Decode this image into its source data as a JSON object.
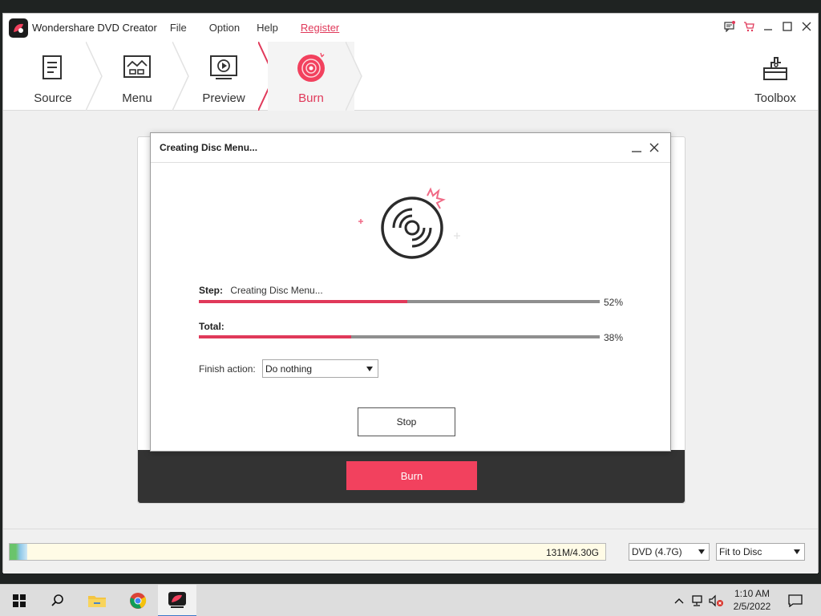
{
  "window": {
    "title": "Wondershare DVD Creator",
    "menu": [
      "File",
      "Option",
      "Help"
    ],
    "register": "Register"
  },
  "steps": [
    {
      "label": "Source",
      "icon": "document-icon",
      "active": false
    },
    {
      "label": "Menu",
      "icon": "image-grid-icon",
      "active": false
    },
    {
      "label": "Preview",
      "icon": "play-screen-icon",
      "active": false
    },
    {
      "label": "Burn",
      "icon": "disc-icon",
      "active": true
    }
  ],
  "toolbox": {
    "label": "Toolbox",
    "icon": "toolbox-icon"
  },
  "dialog": {
    "title": "Creating Disc Menu...",
    "step_label": "Step:",
    "step_value": "Creating Disc Menu...",
    "step_percent": "52%",
    "step_progress": 0.52,
    "total_label": "Total:",
    "total_percent": "38%",
    "total_progress": 0.38,
    "finish_label": "Finish action:",
    "finish_value": "Do nothing",
    "stop_label": "Stop"
  },
  "panel": {
    "burn_label": "Burn"
  },
  "status": {
    "capacity_text": "131M/4.30G",
    "capacity_used": 0.03,
    "disc_type": "DVD (4.7G)",
    "fit_mode": "Fit to Disc"
  },
  "taskbar": {
    "time": "1:10 AM",
    "date": "2/5/2022"
  },
  "colors": {
    "accent": "#e0395a",
    "burn_button": "#f2415e"
  }
}
